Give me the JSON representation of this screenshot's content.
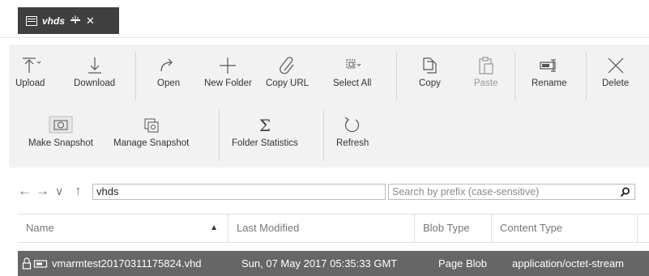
{
  "tab": {
    "title": "vhds",
    "pin_icon": "pin-icon",
    "close_label": "✕"
  },
  "toolbar": {
    "row1": [
      {
        "label": "Upload",
        "icon": "upload-icon"
      },
      {
        "label": "Download",
        "icon": "download-icon"
      },
      {
        "label": "Open",
        "icon": "open-arrow-icon"
      },
      {
        "label": "New Folder",
        "icon": "plus-icon"
      },
      {
        "label": "Copy URL",
        "icon": "link-icon"
      },
      {
        "label": "Select All",
        "icon": "select-all-icon"
      },
      {
        "label": "Copy",
        "icon": "copy-icon"
      },
      {
        "label": "Paste",
        "icon": "paste-icon",
        "disabled": true
      },
      {
        "label": "Rename",
        "icon": "rename-icon"
      },
      {
        "label": "Delete",
        "icon": "delete-icon"
      }
    ],
    "row2": [
      {
        "label": "Make Snapshot",
        "icon": "camera-icon"
      },
      {
        "label": "Manage Snapshot",
        "icon": "manage-snapshot-icon"
      },
      {
        "label": "Folder Statistics",
        "icon": "sigma-icon"
      },
      {
        "label": "Refresh",
        "icon": "refresh-icon"
      }
    ]
  },
  "address": {
    "path": "vhds",
    "search_placeholder": "Search by prefix (case-sensitive)"
  },
  "columns": [
    "Name",
    "Last Modified",
    "Blob Type",
    "Content Type"
  ],
  "rows": [
    {
      "name": "vmarmtest20170311175824.vhd",
      "last_modified": "Sun, 07 May 2017 05:35:33 GMT",
      "blob_type": "Page Blob",
      "content_type": "application/octet-stream"
    }
  ],
  "colors": {
    "tab_bg": "#3f3f3f",
    "toolbar_bg": "#f2f2f2",
    "selected_row": "#666666"
  }
}
